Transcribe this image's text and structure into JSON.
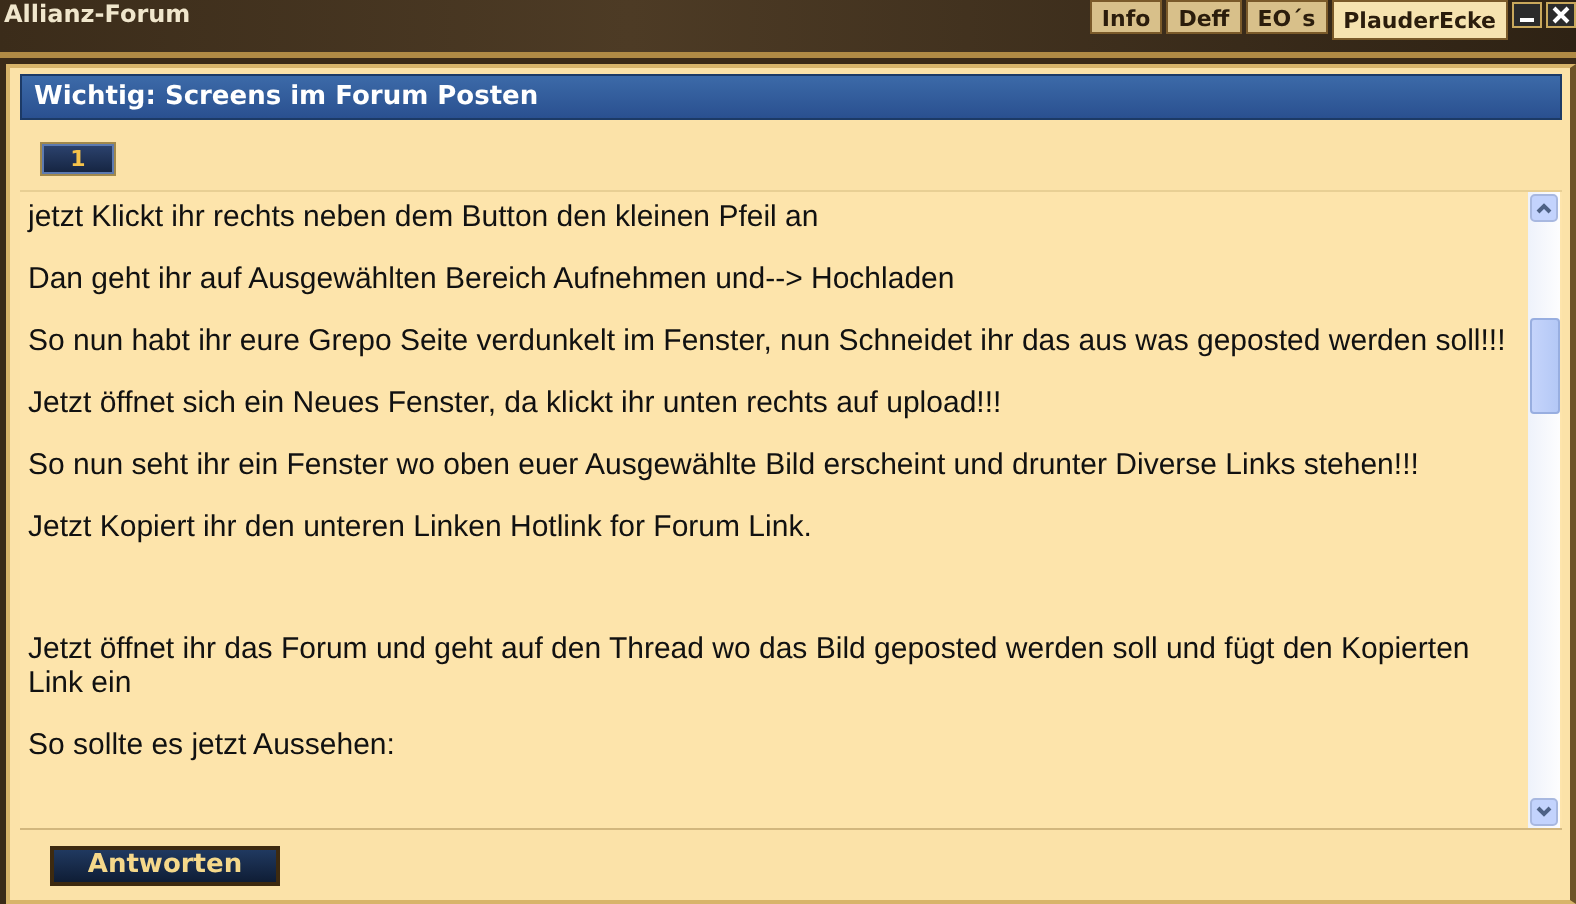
{
  "window": {
    "title": "Allianz-Forum"
  },
  "tabs": [
    {
      "label": "Info",
      "selected": false
    },
    {
      "label": "Deff",
      "selected": false
    },
    {
      "label": "EO´s",
      "selected": false
    },
    {
      "label": "PlauderEcke",
      "selected": true
    }
  ],
  "thread": {
    "title": "Wichtig: Screens im Forum Posten"
  },
  "pages": [
    {
      "label": "1",
      "selected": true
    }
  ],
  "post": {
    "paragraphs": [
      {
        "text": "jetzt Klickt ihr rechts neben dem Button den kleinen Pfeil an",
        "gap_before": false
      },
      {
        "text": "Dan geht ihr auf Ausgewählten Bereich Aufnehmen und--> Hochladen",
        "gap_before": false
      },
      {
        "text": "So nun habt ihr eure Grepo Seite verdunkelt im Fenster, nun Schneidet ihr das aus was geposted werden soll!!!",
        "gap_before": false
      },
      {
        "text": "Jetzt öffnet sich ein Neues Fenster, da klickt ihr unten rechts auf upload!!!",
        "gap_before": false
      },
      {
        "text": "So nun seht ihr ein Fenster wo oben euer Ausgewählte Bild erscheint und drunter Diverse Links stehen!!!",
        "gap_before": false
      },
      {
        "text": "Jetzt Kopiert ihr den unteren Linken Hotlink for Forum Link.",
        "gap_before": false
      },
      {
        "text": "Jetzt öffnet ihr das Forum und geht auf den Thread wo das Bild geposted werden soll und fügt den Kopierten Link ein",
        "gap_before": true
      },
      {
        "text": "So sollte es jetzt Aussehen:",
        "gap_before": false
      }
    ]
  },
  "reply_button": {
    "label": "Antworten"
  }
}
